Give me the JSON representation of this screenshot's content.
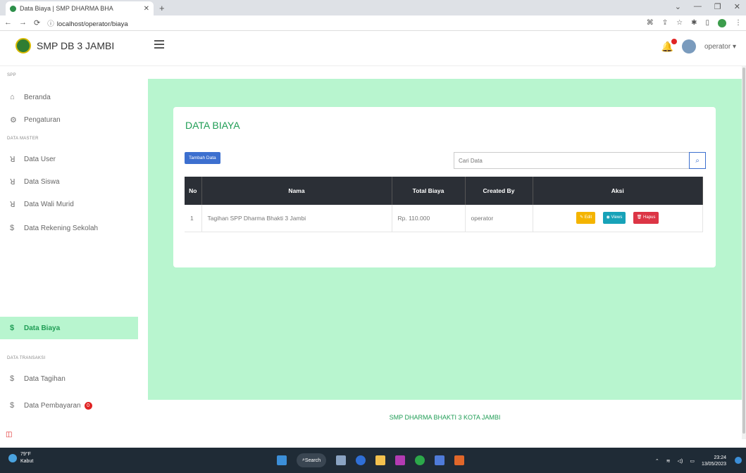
{
  "browser": {
    "tab_title": "Data Biaya | SMP DHARMA BHA",
    "url": "localhost/operator/biaya"
  },
  "header": {
    "brand": "SMP DB 3 JAMBI",
    "user": "operator ▾"
  },
  "sidebar": {
    "section_spp": "SPP",
    "section_master": "DATA MASTER",
    "section_transaksi": "DATA TRANSAKSI",
    "items": [
      {
        "label": "Beranda",
        "icon": "home-icon"
      },
      {
        "label": "Pengaturan",
        "icon": "gear-icon"
      },
      {
        "label": "Data User",
        "icon": "user-icon"
      },
      {
        "label": "Data Siswa",
        "icon": "user-icon"
      },
      {
        "label": "Data Wali Murid",
        "icon": "user-icon"
      },
      {
        "label": "Data Rekening Sekolah",
        "icon": "dollar-icon"
      },
      {
        "label": "Data Biaya",
        "icon": "dollar-icon",
        "active": true
      },
      {
        "label": "Data Tagihan",
        "icon": "dollar-icon"
      },
      {
        "label": "Data Pembayaran",
        "icon": "dollar-icon",
        "badge": "0"
      }
    ]
  },
  "main": {
    "title": "DATA BIAYA",
    "add_button": "Tambah Data",
    "search_placeholder": "Cari Data",
    "table": {
      "headers": [
        "No",
        "Nama",
        "Total Biaya",
        "Created By",
        "Aksi"
      ],
      "rows": [
        {
          "no": "1",
          "nama": "Tagihan SPP Dharma Bhakti 3 Jambi",
          "total": "Rp. 110.000",
          "created_by": "operator"
        }
      ],
      "actions": {
        "edit": "Edit",
        "view": "Views",
        "delete": "Hapus"
      }
    }
  },
  "footer": "SMP DHARMA BHAKTI 3 KOTA JAMBI",
  "taskbar": {
    "temp": "79°F",
    "weather": "Kabut",
    "search": "Search",
    "time": "23:24",
    "date": "13/05/2023"
  },
  "colors": {
    "accent_green": "#1f9d55",
    "mint_bg": "#b8f5cf",
    "primary_blue": "#3c6fcf",
    "table_header": "#2b2f36"
  }
}
